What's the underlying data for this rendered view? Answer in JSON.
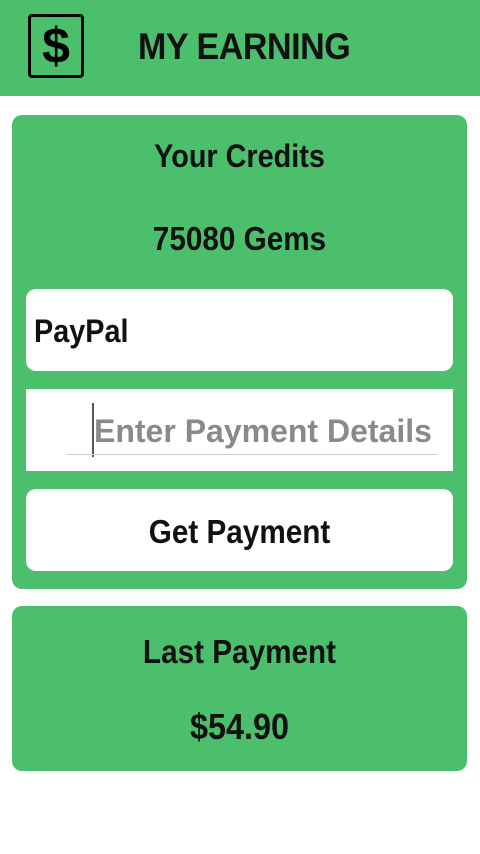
{
  "header": {
    "icon": "dollar-icon",
    "icon_glyph": "$",
    "title": "MY EARNING",
    "color": "#4cbf6d"
  },
  "credits": {
    "title": "Your Credits",
    "value": "75080 Gems"
  },
  "payment_method": {
    "selected": "PayPal"
  },
  "payment_details": {
    "value": "",
    "placeholder": "Enter Payment Details"
  },
  "get_payment_label": "Get Payment",
  "last_payment": {
    "title": "Last Payment",
    "amount": "$54.90"
  }
}
